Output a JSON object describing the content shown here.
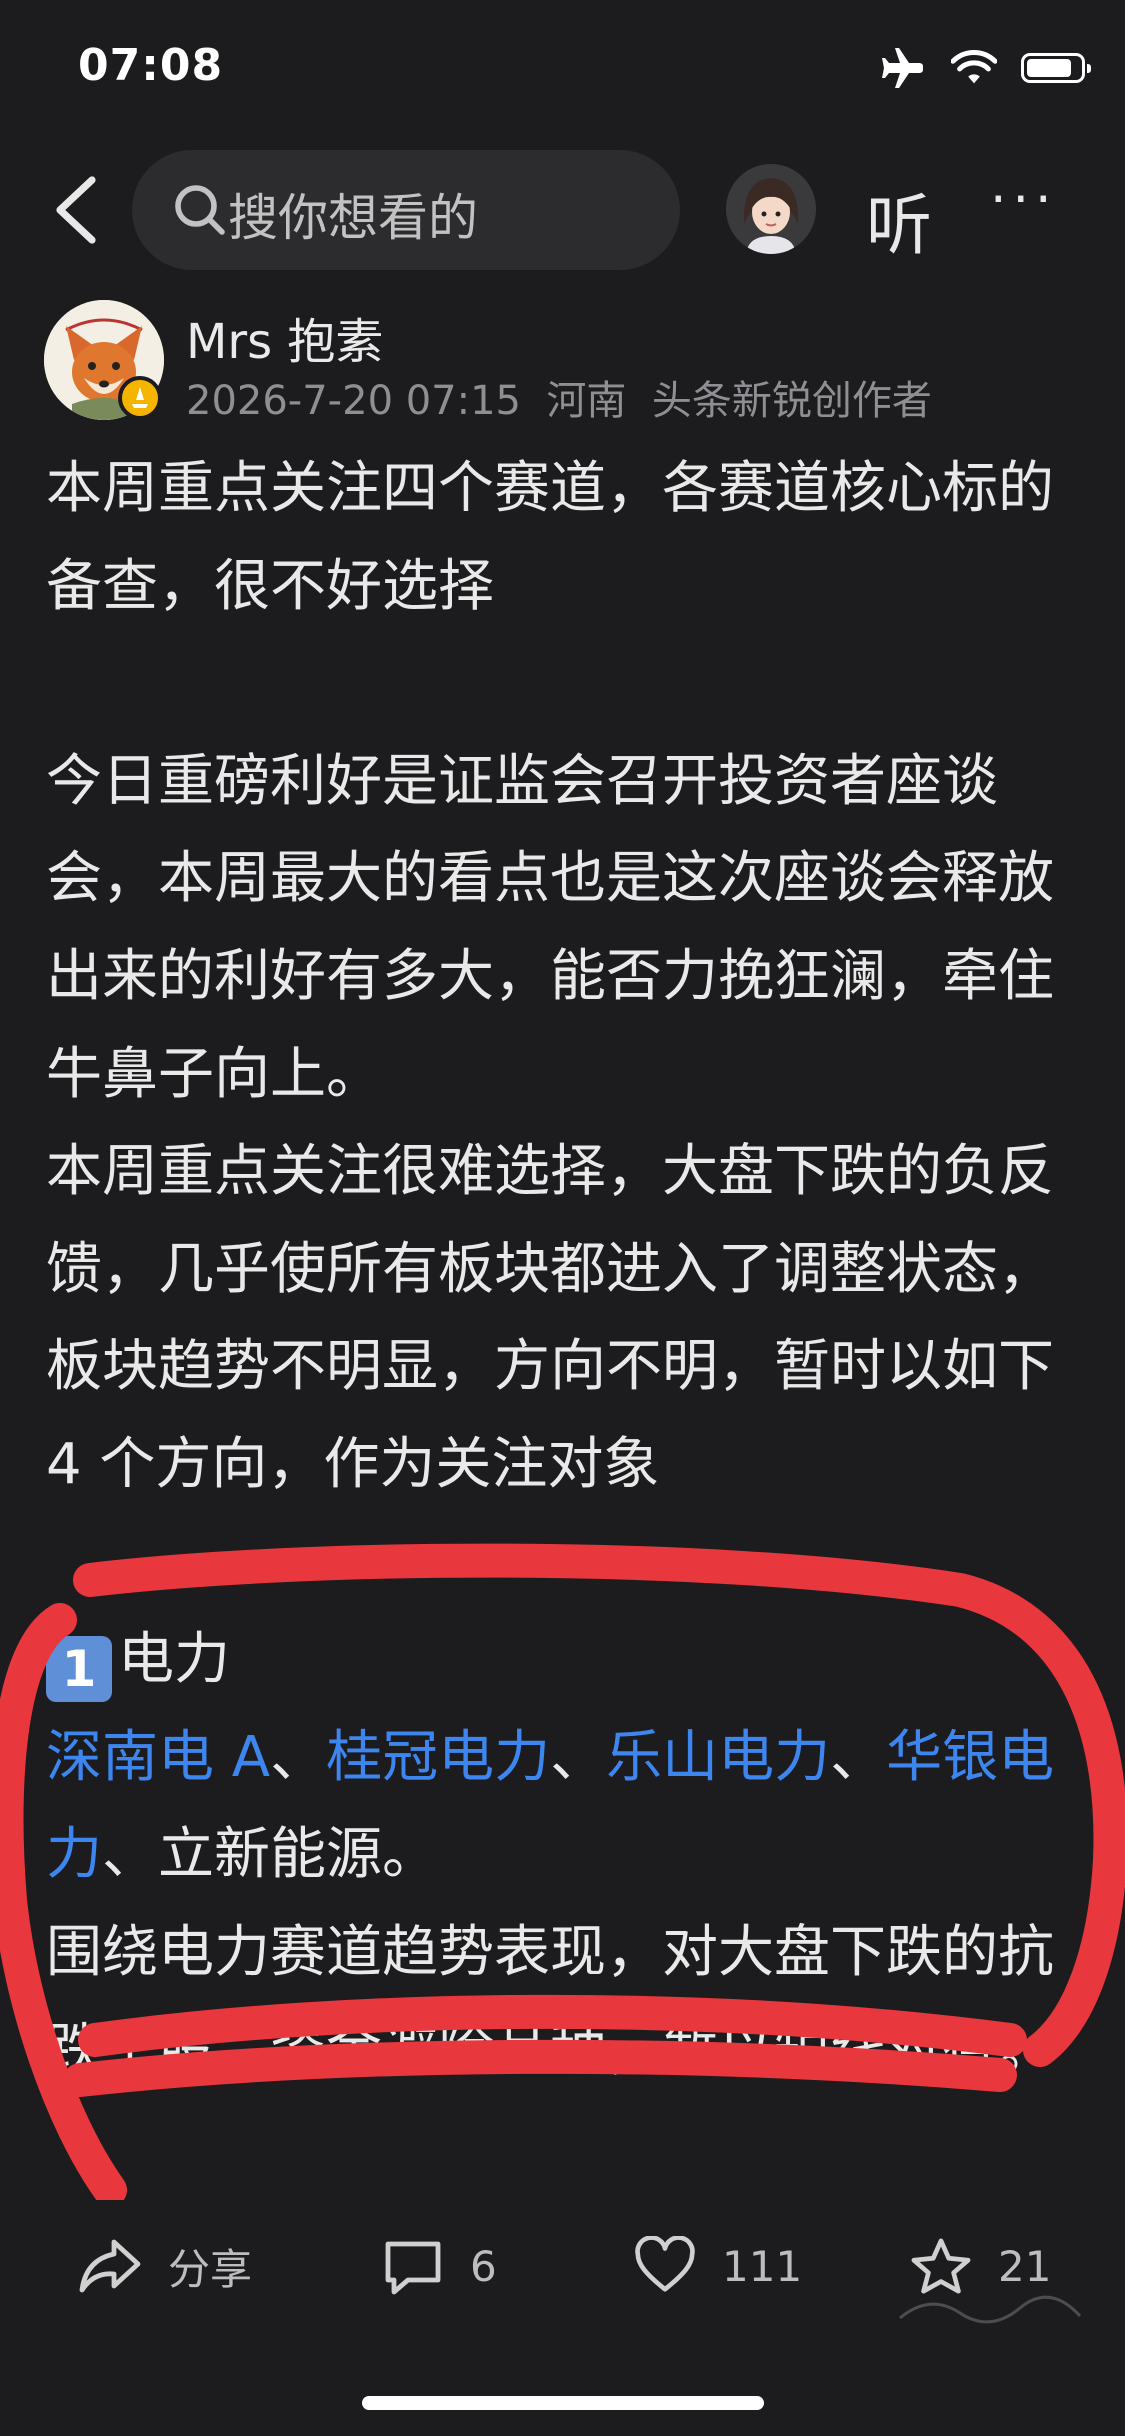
{
  "status_bar": {
    "time": "07:08",
    "icons": [
      "airplane-icon",
      "wifi-icon",
      "battery-icon"
    ],
    "battery_level": 0.85
  },
  "nav": {
    "search_placeholder": "搜你想看的",
    "listen_label": "听",
    "more_label": "···"
  },
  "author": {
    "name": "Mrs 抱素",
    "meta": "2026-7-20 07:15  河南  头条新锐创作者"
  },
  "article": {
    "para1": "本周重点关注四个赛道，各赛道核心标的备查，很不好选择",
    "para2": "今日重磅利好是证监会召开投资者座谈会，本周最大的看点也是这次座谈会释放出来的利好有多大，能否力挽狂澜，牵住牛鼻子向上。",
    "para3": "本周重点关注很难选择，大盘下跌的负反馈，几乎使所有板块都进入了调整状态，板块趋势不明显，方向不明，暂时以如下 4 个方向，作为关注对象",
    "section1": {
      "badge": "1",
      "title": "电力",
      "stocks": [
        "深南电 A",
        "桂冠电力",
        "乐山电力",
        "华银电力"
      ],
      "sep": "、",
      "tail": "、立新能源。"
    },
    "para4": "围绕电力赛道趋势表现，对大盘下跌的抗跌个股，资金避险品种，暂以短线对待。"
  },
  "bottom_bar": {
    "share_label": "分享",
    "comments": "6",
    "likes": "111",
    "favorites": "21"
  },
  "colors": {
    "background": "#1c1c1e",
    "link": "#3d86f0",
    "annotation": "#e8373d"
  }
}
